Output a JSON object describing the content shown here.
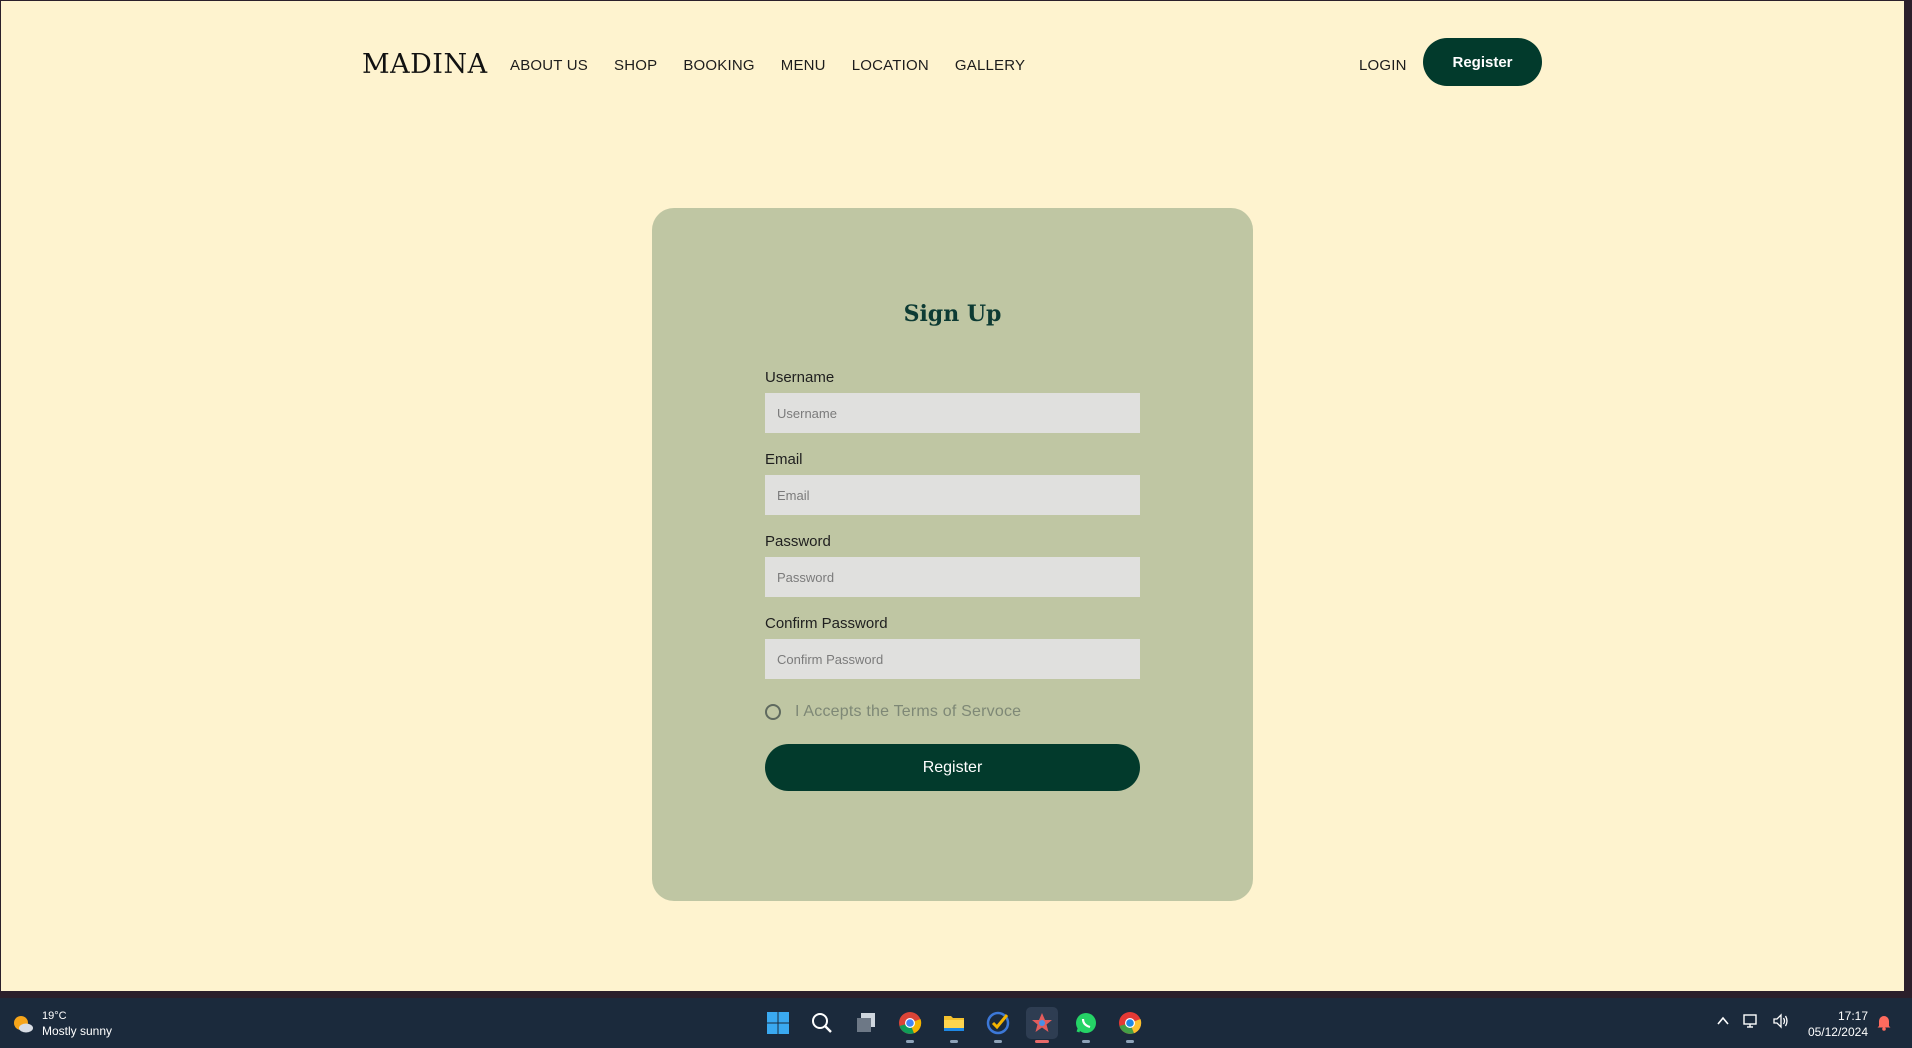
{
  "header": {
    "logo": "MADINA",
    "nav": [
      "ABOUT US",
      "SHOP",
      "BOOKING",
      "MENU",
      "LOCATION",
      "GALLERY"
    ],
    "login_label": "LOGIN",
    "register_label": "Register"
  },
  "form": {
    "title": "Sign Up",
    "fields": [
      {
        "label": "Username",
        "placeholder": "Username",
        "value": ""
      },
      {
        "label": "Email",
        "placeholder": "Email",
        "value": ""
      },
      {
        "label": "Password",
        "placeholder": "Password",
        "value": ""
      },
      {
        "label": "Confirm Password",
        "placeholder": "Confirm Password",
        "value": ""
      }
    ],
    "terms_label": "I Accepts the Terms of Servoce",
    "terms_checked": false,
    "submit_label": "Register"
  },
  "taskbar": {
    "weather_temp": "19°C",
    "weather_condition": "Mostly sunny",
    "apps": [
      "windows-start-icon",
      "search-icon",
      "task-view-icon",
      "chrome-icon",
      "file-explorer-icon",
      "todo-icon",
      "paint-icon",
      "whatsapp-icon",
      "chrome-canary-icon"
    ],
    "time": "17:17",
    "date": "05/12/2024"
  },
  "colors": {
    "page_bg": "#fef3cf",
    "card_bg": "#bfc6a3",
    "accent": "#023a2c",
    "taskbar_bg": "#1b2a3c"
  }
}
